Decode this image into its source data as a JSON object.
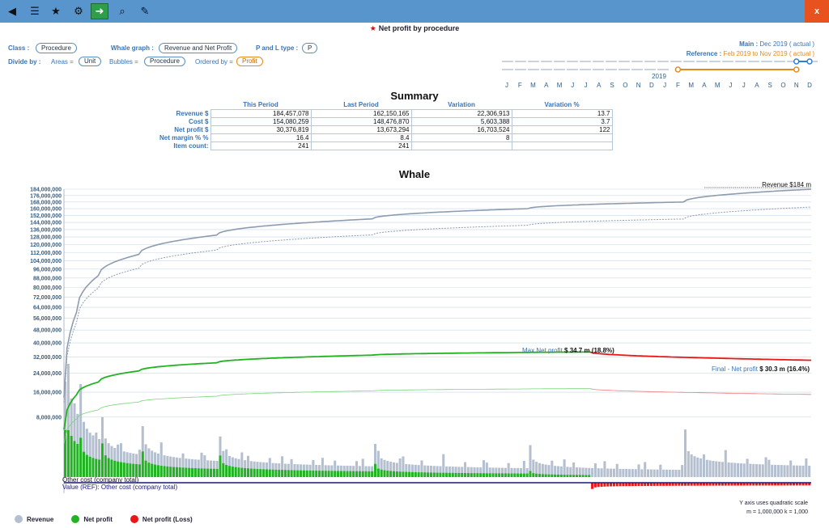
{
  "toolbar": {
    "close_label": "x"
  },
  "title": "Net profit by procedure",
  "controls": {
    "class_label": "Class :",
    "class_value": "Procedure",
    "whale_label": "Whale graph :",
    "whale_value": "Revenue and Net Profit",
    "pl_label": "P and L type :",
    "pl_value": "P",
    "divide_label": "Divide by :",
    "areas_label": "Areas =",
    "areas_value": "Unit",
    "bubbles_label": "Bubbles =",
    "bubbles_value": "Procedure",
    "ordered_label": "Ordered by =",
    "ordered_value": "Profit"
  },
  "period": {
    "main_label": "Main : ",
    "main_value": "Dec 2019 ( actual )",
    "ref_label": "Reference : ",
    "ref_value": "Feb 2019 to Nov 2019 ( actual )",
    "year": "2019",
    "months": [
      "J",
      "F",
      "M",
      "A",
      "M",
      "J",
      "J",
      "A",
      "S",
      "O",
      "N",
      "D",
      "J",
      "F",
      "M",
      "A",
      "M",
      "J",
      "J",
      "A",
      "S",
      "O",
      "N",
      "D"
    ]
  },
  "summary": {
    "title": "Summary",
    "headers": [
      "This Period",
      "Last Period",
      "Variation",
      "Variation %"
    ],
    "rows": [
      {
        "label": "Revenue $",
        "values": [
          "184,457,078",
          "162,150,165",
          "22,306,913",
          "13.7"
        ]
      },
      {
        "label": "Cost $",
        "values": [
          "154,080,259",
          "148,476,870",
          "5,603,388",
          "3.7"
        ]
      },
      {
        "label": "Net profit $",
        "values": [
          "30,376,819",
          "13,673,294",
          "16,703,524",
          "122"
        ]
      },
      {
        "label": "Net margin % %",
        "values": [
          "16.4",
          "8.4",
          "8",
          ""
        ]
      },
      {
        "label": "Item count:",
        "values": [
          "241",
          "241",
          "",
          ""
        ]
      }
    ]
  },
  "chart_data": {
    "type": "line",
    "title": "Whale",
    "y_scale": "quadratic",
    "ylim": [
      0,
      184000000
    ],
    "y_ticks": [
      8000000,
      16000000,
      24000000,
      32000000,
      40000000,
      48000000,
      56000000,
      64000000,
      72000000,
      80000000,
      88000000,
      96000000,
      104000000,
      112000000,
      120000000,
      128000000,
      136000000,
      144000000,
      152000000,
      160000000,
      168000000,
      176000000,
      184000000
    ],
    "y_tick_labels": [
      "8,000,000",
      "16,000,000",
      "24,000,000",
      "32,000,000",
      "40,000,000",
      "48,000,000",
      "56,000,000",
      "64,000,000",
      "72,000,000",
      "80,000,000",
      "88,000,000",
      "96,000,000",
      "104,000,000",
      "112,000,000",
      "120,000,000",
      "128,000,000",
      "136,000,000",
      "144,000,000",
      "152,000,000",
      "160,000,000",
      "168,000,000",
      "176,000,000",
      "184,000,000"
    ],
    "item_count": 241,
    "series": [
      {
        "name": "Revenue",
        "color": "#8e9cb0",
        "x": [
          1,
          5,
          12,
          25,
          50,
          100,
          150,
          200,
          241
        ],
        "values": [
          14000000,
          60000000,
          90000000,
          110000000,
          130000000,
          148000000,
          160000000,
          168000000,
          184000000
        ]
      },
      {
        "name": "Net profit",
        "color": "#22b322",
        "x": [
          1,
          5,
          12,
          25,
          50,
          100,
          150,
          170,
          241
        ],
        "values": [
          5000000,
          15000000,
          20000000,
          25000000,
          29000000,
          33000000,
          34500000,
          34700000,
          30300000
        ]
      }
    ],
    "annotations": {
      "revenue_end": "Revenue $184 m",
      "max_label": "Max.Net profit ",
      "max_value": "$ 34.7 m (18.8%)",
      "final_label": "Final - Net profit ",
      "final_value": "$ 30.3 m (16.4%)",
      "other_cost": "Other cost (company total)",
      "ref_other_cost": "Value (REF): Other cost (company total)"
    },
    "legend": [
      {
        "name": "Revenue",
        "color": "#b4bfcf"
      },
      {
        "name": "Net profit",
        "color": "#22b322"
      },
      {
        "name": "Net profit (Loss)",
        "color": "#e81818"
      }
    ]
  },
  "footer": {
    "scale_note": "Y axis uses quadratic scale",
    "units_note": "m = 1,000,000   k = 1,000"
  },
  "colors": {
    "accent": "#5795cc",
    "profit": "#22b322",
    "loss": "#e81818",
    "revenue": "#8e9cb0",
    "ref": "#e58a1f"
  }
}
